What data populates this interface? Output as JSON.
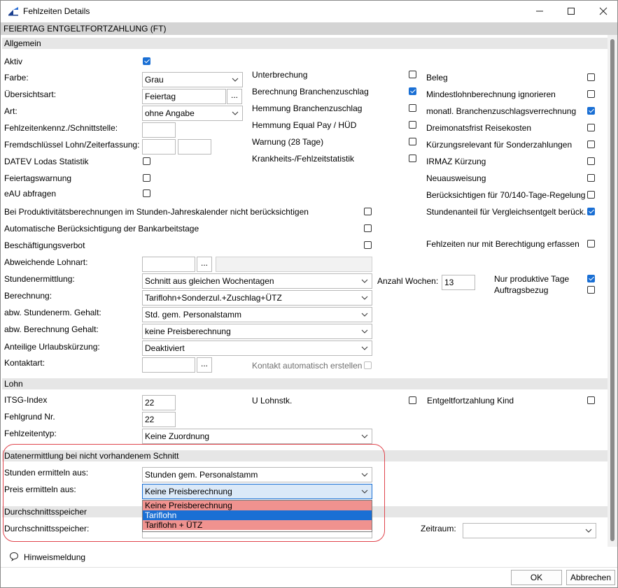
{
  "window": {
    "title": "Fehlzeiten Details"
  },
  "header": "FEIERTAG ENTGELTFORTZAHLUNG (FT)",
  "sections": {
    "allgemein": "Allgemein",
    "lohn": "Lohn",
    "datenermittlung": "Datenermittlung bei nicht vorhandenem Schnitt",
    "durchschnitt": "Durchschnittsspeicher"
  },
  "colors": {
    "accent": "#1a6fd4",
    "highlight_red": "#e0454d",
    "option_red": "#f0928f"
  },
  "labels": {
    "aktiv": "Aktiv",
    "farbe": "Farbe:",
    "uebersichtsart": "Übersichtsart:",
    "art": "Art:",
    "kennz": "Fehlzeitenkennz./Schnittstelle:",
    "fremd": "Fremdschlüssel Lohn/Zeiterfassung:",
    "datev": "DATEV Lodas Statistik",
    "feiertagswarnung": "Feiertagswarnung",
    "eau": "eAU abfragen",
    "produktiv": "Bei Produktivitätsberechnungen im Stunden-Jahreskalender nicht berücksichtigen",
    "bankarbeit": "Automatische Berücksichtigung der Bankarbeitstage",
    "beschaeftigung": "Beschäftigungsverbot",
    "abw_lohnart": "Abweichende Lohnart:",
    "stundenermittlung": "Stundenermittlung:",
    "berechnung": "Berechnung:",
    "abw_stunden": "abw. Stundenerm. Gehalt:",
    "abw_berechnung": "abw. Berechnung Gehalt:",
    "anteilige": "Anteilige Urlaubskürzung:",
    "kontaktart": "Kontaktart:",
    "kontakt_auto": "Kontakt automatisch erstellen",
    "unterbrechung": "Unterbrechung",
    "berechnung_bz": "Berechnung Branchenzuschlag",
    "hemmung_bz": "Hemmung Branchenzuschlag",
    "hemmung_ep": "Hemmung Equal Pay / HÜD",
    "warnung": "Warnung (28 Tage)",
    "krankheit": "Krankheits-/Fehlzeitstatistik",
    "beleg": "Beleg",
    "mindestlohn": "Mindestlohnberechnung ignorieren",
    "monatl": "monatl. Branchenzuschlagsverrechnung",
    "dreimonat": "Dreimonatsfrist Reisekosten",
    "kuerzung": "Kürzungsrelevant für Sonderzahlungen",
    "irmaz": "IRMAZ Kürzung",
    "neuausweisung": "Neuausweisung",
    "beruecksichtigen": "Berücksichtigen für 70/140-Tage-Regelung",
    "stundenanteil": "Stundenanteil für Vergleichsentgelt berück.",
    "nur_berechtigung": "Fehlzeiten nur mit Berechtigung erfassen",
    "anzahl_wochen": "Anzahl Wochen:",
    "nur_produktiv": "Nur produktive Tage",
    "auftragsbezug": "Auftragsbezug",
    "itsg": "ITSG-Index",
    "fehlgrund": "Fehlgrund Nr.",
    "fehlzeitentyp": "Fehlzeitentyp:",
    "u_lohnstk": "U Lohnstk.",
    "entgelt_kind": "Entgeltfortzahlung Kind",
    "stunden_aus": "Stunden ermitteln aus:",
    "preis_aus": "Preis ermitteln aus:",
    "durchschnittsspeicher": "Durchschnittsspeicher:",
    "zeitraum": "Zeitraum:",
    "hinweis": "Hinweismeldung"
  },
  "values": {
    "farbe": "Grau",
    "uebersichtsart": "Feiertag",
    "art": "ohne Angabe",
    "stundenermittlung": "Schnitt aus gleichen Wochentagen",
    "berechnung": "Tariflohn+Sonderzul.+Zuschlag+ÜTZ",
    "abw_stunden": "Std. gem. Personalstamm",
    "abw_berechnung": "keine Preisberechnung",
    "anteilige": "Deaktiviert",
    "anzahl_wochen": "13",
    "itsg": "22",
    "fehlgrund": "22",
    "fehlzeitentyp": "Keine Zuordnung",
    "stunden_aus": "Stunden gem. Personalstamm",
    "preis_aus": "Keine Preisberechnung"
  },
  "dropdown_options": [
    "Keine Preisberechnung",
    "Tariflohn",
    "Tariflohn + ÜTZ"
  ],
  "buttons": {
    "ok": "OK",
    "cancel": "Abbrechen",
    "dots": "..."
  }
}
